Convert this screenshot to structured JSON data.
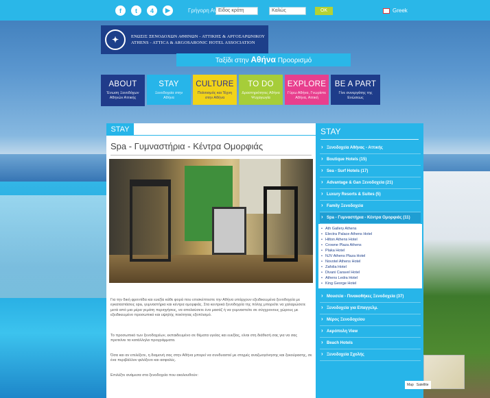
{
  "topbar": {
    "social_icons": [
      "facebook-icon",
      "twitter-icon",
      "foursquare-icon",
      "youtube-icon"
    ],
    "search_label": "Γρήγορη Αναζ.",
    "search_value": "Είδος κράτη",
    "region_value": "Καλώς",
    "go_label": "ΟΚ",
    "lang_label": "Greek"
  },
  "logo": {
    "line1": "ΕΝΩΣΙΣ ΞΕΝΟΔΟΧΩΝ ΑΘΗΝΩΝ - ΑΤΤΙΚΗΣ & ΑΡΓΟΣΑΡΩΝΙΚΟΥ",
    "line2": "ATHENS - ATTICA & ARGOSARONIC HOTEL ASSOCIATION"
  },
  "tagline": {
    "prefix": "Ταξίδι στην",
    "city": "Αθήνα",
    "suffix": "Προορισμό"
  },
  "nav": [
    {
      "label": "ABOUT",
      "sub": "Ένωση Ξενοδόχων Αθηνών Αττικής"
    },
    {
      "label": "STAY",
      "sub": "Ξενοδοχεία στην Αθήνα"
    },
    {
      "label": "CULTURE",
      "sub": "Πολιτισμός και Τέχνη στην Αθήνα"
    },
    {
      "label": "TO DO",
      "sub": "Δραστηριότητες Αθήνα Ψυχαγωγία"
    },
    {
      "label": "EXPLORE",
      "sub": "Γύρω Αθήνα, Γνωρίστε Αθήνα, Αττική"
    },
    {
      "label": "BE A PART",
      "sub": "Γίνε συνεργάτης της Ενώσεως"
    }
  ],
  "main": {
    "section_badge": "STAY",
    "page_title": "Spa - Γυμναστήρια - Κέντρα Ομορφιάς",
    "paragraphs": [
      "Για την δική φροντίδα και ευεξία κάθε φορά που επισκέπτεστε την Αθήνα υπάρχουν εξειδικευμένα ξενοδοχεία με εγκαταστάσεις spa, γυμναστήρια και κέντρα ομορφιάς. Στα κεντρικά ξενοδοχεία της πόλης μπορείτε να χαλαρώσετε μετά από μια μέρα γεμάτη περιηγήσεις, να απολαύσετε ένα μασάζ ή να γυμναστείτε σε σύγχρονους χώρους με εξειδικευμένο προσωπικό και υψηλής ποιότητας εξοπλισμό.",
      "Το προσωπικό των ξενοδοχείων, εκπαιδευμένο σε θέματα υγείας και ευεξίας, είναι στη διάθεσή σας για να σας προτείνει τα κατάλληλα προγράμματα.",
      "Όσα και αν επιλέξετε, η διαμονή σας στην Αθήνα μπορεί να συνδυαστεί με στιγμές αναζωογόνησης και ξεκούρασης, σε ένα περιβάλλον φιλόξενο και ασφαλές.",
      "Επιλέξτε ανάμεσα στα ξενοδοχεία που ακολουθούν:"
    ]
  },
  "sidebar": {
    "title": "STAY",
    "items": [
      "Ξενοδοχεία Αθήνας - Αττικής",
      "Boutique Hotels (15)",
      "Sea - Surf Hotels (17)",
      "Advantage & Gan Ξενοδοχεία (21)",
      "Luxury Resorts & Suites (5)",
      "Family Ξενοδοχεία"
    ],
    "active_item": "Spa - Γυμναστήρια - Κέντρα Ομορφιάς (11)",
    "sub_items": [
      "Ath Gallery Athens",
      "Electra Palace Athens Hotel",
      "Hilton Athens Hotel",
      "Crowne Plaza Athens",
      "Plaka Hotel",
      "NJV Athens Plaza Hotel",
      "Novotel Athens Hotel",
      "Zafolia Hotel",
      "Divani Caravel Hotel",
      "Athens Ledra Hotel",
      "King George Hotel"
    ],
    "items_after": [
      "Μουσεία - Πινακοθήκες Ξενοδοχεία (37)",
      "Ξενοδοχεία για Επαγγελμ.",
      "Μέρος Ξενοδοχείου",
      "Ακρόπολη View",
      "Beach Hotels",
      "Ξενοδοχεία Σχολής"
    ]
  },
  "map": {
    "tab_map": "Map",
    "tab_satellite": "Satellite"
  }
}
